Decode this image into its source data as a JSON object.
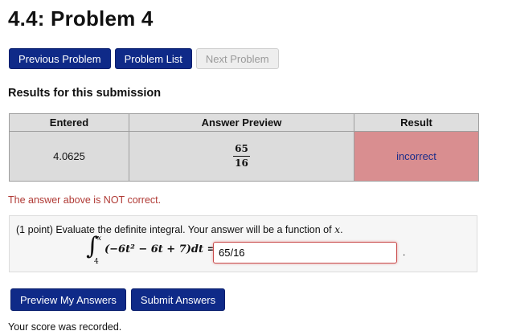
{
  "page": {
    "title": "4.4: Problem 4"
  },
  "nav_buttons": {
    "previous": "Previous Problem",
    "list": "Problem List",
    "next": "Next Problem"
  },
  "results": {
    "heading": "Results for this submission",
    "columns": [
      "Entered",
      "Answer Preview",
      "Result"
    ],
    "row": {
      "entered": "4.0625",
      "preview_numerator": "65",
      "preview_denominator": "16",
      "result": "incorrect"
    },
    "incorrect_color": "#d98e90"
  },
  "feedback": {
    "message": "The answer above is NOT correct."
  },
  "problem": {
    "text": "(1 point) Evaluate the definite integral. Your answer will be a function of",
    "variable": "x",
    "text_end": ".",
    "integral": {
      "upper": "x",
      "lower": "4",
      "integrand": "(−6t² − 6t + 7)dt ="
    },
    "answer_value": "65/16",
    "after_input": "."
  },
  "submit_buttons": {
    "preview": "Preview My Answers",
    "submit": "Submit Answers"
  },
  "status": {
    "score_message": "Your score was recorded."
  },
  "colors": {
    "primary_button": "#0f2a88",
    "error_text": "#b03a35"
  }
}
